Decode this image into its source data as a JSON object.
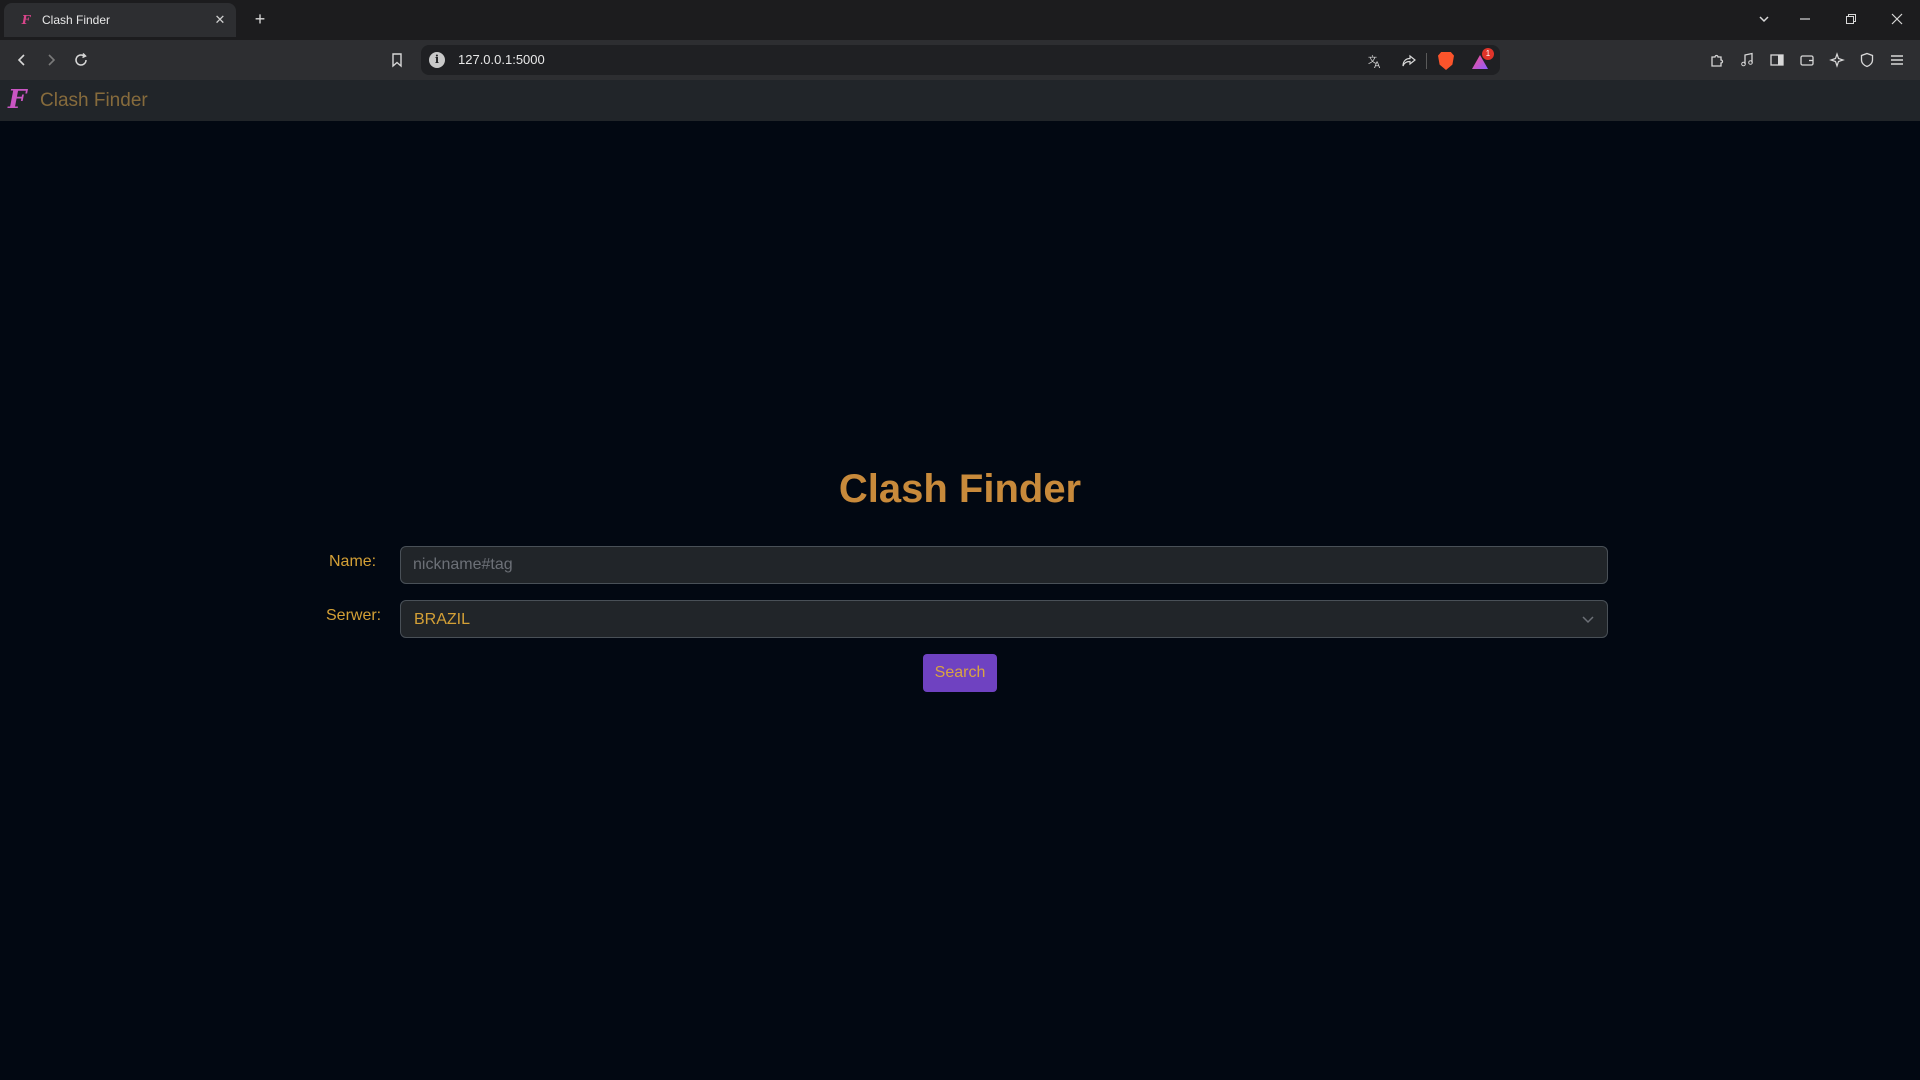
{
  "browser": {
    "tab_title": "Clash Finder",
    "tab_favicon": "F",
    "url": "127.0.0.1:5000",
    "rewards_badge": "1",
    "icons": {
      "back": "arrow-left-icon",
      "forward": "arrow-right-icon",
      "reload": "reload-icon",
      "bookmark": "bookmark-icon",
      "site_info": "info-icon",
      "translate": "translate-icon",
      "share": "share-icon",
      "brave_shields": "brave-lion-icon",
      "brave_rewards": "brave-rewards-icon",
      "extensions": "puzzle-icon",
      "media": "music-note-icon",
      "sidebar": "sidebar-icon",
      "wallet": "wallet-icon",
      "leo": "sparkle-icon",
      "vpn": "shield-icon",
      "menu": "hamburger-menu-icon"
    }
  },
  "navbar": {
    "brand_logo": "F",
    "brand_text": "Clash Finder"
  },
  "main": {
    "title": "Clash Finder",
    "name_label": "Name:",
    "name_placeholder": "nickname#tag",
    "name_value": "",
    "server_label": "Serwer:",
    "server_value": "BRAZIL",
    "search_label": "Search"
  },
  "colors": {
    "page_bg": "#020812",
    "navbar_bg": "#212529",
    "accent_gold": "#c88a3b",
    "button_purple": "#6f42c1"
  }
}
